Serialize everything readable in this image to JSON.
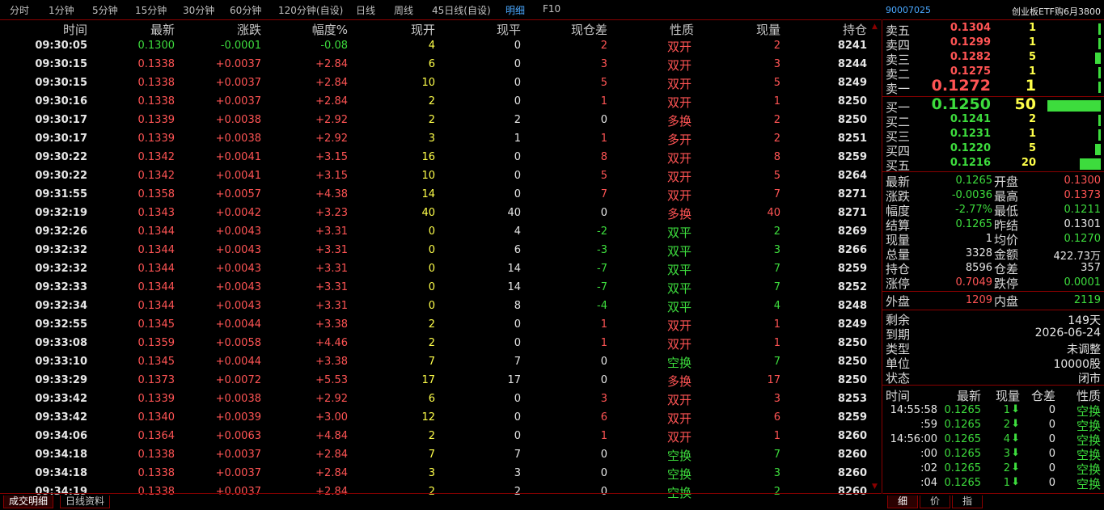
{
  "topbar": {
    "tabs": [
      "分时",
      "1分钟",
      "5分钟",
      "15分钟",
      "30分钟",
      "60分钟",
      "120分钟(自设)",
      "日线",
      "周线",
      "45日线(自设)",
      "明细",
      "F10"
    ],
    "active_index": 10
  },
  "table": {
    "headers": [
      "时间",
      "最新",
      "涨跌",
      "幅度%",
      "现开",
      "现平",
      "现仓差",
      "性质",
      "现量",
      "持仓"
    ],
    "rows": [
      [
        "09:30:05",
        "0.1300",
        "-0.0001",
        "-0.08",
        "4",
        "0",
        "2",
        "双开",
        "2",
        "8241"
      ],
      [
        "09:30:15",
        "0.1338",
        "+0.0037",
        "+2.84",
        "6",
        "0",
        "3",
        "双开",
        "3",
        "8244"
      ],
      [
        "09:30:15",
        "0.1338",
        "+0.0037",
        "+2.84",
        "10",
        "0",
        "5",
        "双开",
        "5",
        "8249"
      ],
      [
        "09:30:16",
        "0.1338",
        "+0.0037",
        "+2.84",
        "2",
        "0",
        "1",
        "双开",
        "1",
        "8250"
      ],
      [
        "09:30:17",
        "0.1339",
        "+0.0038",
        "+2.92",
        "2",
        "2",
        "0",
        "多换",
        "2",
        "8250"
      ],
      [
        "09:30:17",
        "0.1339",
        "+0.0038",
        "+2.92",
        "3",
        "1",
        "1",
        "多开",
        "2",
        "8251"
      ],
      [
        "09:30:22",
        "0.1342",
        "+0.0041",
        "+3.15",
        "16",
        "0",
        "8",
        "双开",
        "8",
        "8259"
      ],
      [
        "09:30:22",
        "0.1342",
        "+0.0041",
        "+3.15",
        "10",
        "0",
        "5",
        "双开",
        "5",
        "8264"
      ],
      [
        "09:31:55",
        "0.1358",
        "+0.0057",
        "+4.38",
        "14",
        "0",
        "7",
        "双开",
        "7",
        "8271"
      ],
      [
        "09:32:19",
        "0.1343",
        "+0.0042",
        "+3.23",
        "40",
        "40",
        "0",
        "多换",
        "40",
        "8271"
      ],
      [
        "09:32:26",
        "0.1344",
        "+0.0043",
        "+3.31",
        "0",
        "4",
        "-2",
        "双平",
        "2",
        "8269"
      ],
      [
        "09:32:32",
        "0.1344",
        "+0.0043",
        "+3.31",
        "0",
        "6",
        "-3",
        "双平",
        "3",
        "8266"
      ],
      [
        "09:32:32",
        "0.1344",
        "+0.0043",
        "+3.31",
        "0",
        "14",
        "-7",
        "双平",
        "7",
        "8259"
      ],
      [
        "09:32:33",
        "0.1344",
        "+0.0043",
        "+3.31",
        "0",
        "14",
        "-7",
        "双平",
        "7",
        "8252"
      ],
      [
        "09:32:34",
        "0.1344",
        "+0.0043",
        "+3.31",
        "0",
        "8",
        "-4",
        "双平",
        "4",
        "8248"
      ],
      [
        "09:32:55",
        "0.1345",
        "+0.0044",
        "+3.38",
        "2",
        "0",
        "1",
        "双开",
        "1",
        "8249"
      ],
      [
        "09:33:08",
        "0.1359",
        "+0.0058",
        "+4.46",
        "2",
        "0",
        "1",
        "双开",
        "1",
        "8250"
      ],
      [
        "09:33:10",
        "0.1345",
        "+0.0044",
        "+3.38",
        "7",
        "7",
        "0",
        "空换",
        "7",
        "8250"
      ],
      [
        "09:33:29",
        "0.1373",
        "+0.0072",
        "+5.53",
        "17",
        "17",
        "0",
        "多换",
        "17",
        "8250"
      ],
      [
        "09:33:42",
        "0.1339",
        "+0.0038",
        "+2.92",
        "6",
        "0",
        "3",
        "双开",
        "3",
        "8253"
      ],
      [
        "09:33:42",
        "0.1340",
        "+0.0039",
        "+3.00",
        "12",
        "0",
        "6",
        "双开",
        "6",
        "8259"
      ],
      [
        "09:34:06",
        "0.1364",
        "+0.0063",
        "+4.84",
        "2",
        "0",
        "1",
        "双开",
        "1",
        "8260"
      ],
      [
        "09:34:18",
        "0.1338",
        "+0.0037",
        "+2.84",
        "7",
        "7",
        "0",
        "空换",
        "7",
        "8260"
      ],
      [
        "09:34:18",
        "0.1338",
        "+0.0037",
        "+2.84",
        "3",
        "3",
        "0",
        "空换",
        "3",
        "8260"
      ],
      [
        "09:34:19",
        "0.1338",
        "+0.0037",
        "+2.84",
        "2",
        "2",
        "0",
        "空换",
        "2",
        "8260"
      ]
    ]
  },
  "bottom_tabs": [
    "成交明细",
    "日线资料"
  ],
  "side": {
    "code": "90007025",
    "name": "创业板ETF购6月3800",
    "asks": [
      {
        "label": "卖五",
        "price": "0.1304",
        "vol": "1",
        "bar": 0.02
      },
      {
        "label": "卖四",
        "price": "0.1299",
        "vol": "1",
        "bar": 0.02
      },
      {
        "label": "卖三",
        "price": "0.1282",
        "vol": "5",
        "bar": 0.1
      },
      {
        "label": "卖二",
        "price": "0.1275",
        "vol": "1",
        "bar": 0.02
      },
      {
        "label": "卖一",
        "price": "0.1272",
        "vol": "1",
        "bar": 0.02
      }
    ],
    "bids": [
      {
        "label": "买一",
        "price": "0.1250",
        "vol": "50",
        "bar": 1.0
      },
      {
        "label": "买二",
        "price": "0.1241",
        "vol": "2",
        "bar": 0.04
      },
      {
        "label": "买三",
        "price": "0.1231",
        "vol": "1",
        "bar": 0.02
      },
      {
        "label": "买四",
        "price": "0.1220",
        "vol": "5",
        "bar": 0.1
      },
      {
        "label": "买五",
        "price": "0.1216",
        "vol": "20",
        "bar": 0.4
      }
    ],
    "quote": [
      [
        "最新",
        "0.1265",
        "开盘",
        "0.1300"
      ],
      [
        "涨跌",
        "-0.0036",
        "最高",
        "0.1373"
      ],
      [
        "幅度",
        "-2.77%",
        "最低",
        "0.1211"
      ],
      [
        "结算",
        "0.1265",
        "昨结",
        "0.1301"
      ],
      [
        "现量",
        "1",
        "均价",
        "0.1270"
      ],
      [
        "总量",
        "3328",
        "金额",
        "422.73万"
      ],
      [
        "持仓",
        "8596",
        "仓差",
        "357"
      ],
      [
        "涨停",
        "0.7049",
        "跌停",
        "0.0001"
      ]
    ],
    "outer": [
      "外盘",
      "1209",
      "内盘",
      "2119"
    ],
    "info": [
      [
        "剩余",
        "149天"
      ],
      [
        "到期",
        "2026-06-24"
      ],
      [
        "类型",
        "未调整"
      ],
      [
        "单位",
        "10000股"
      ],
      [
        "状态",
        "闭市"
      ]
    ],
    "ticks_header": [
      "时间",
      "最新",
      "现量",
      "仓差",
      "性质"
    ],
    "ticks": [
      [
        "14:55:58",
        "0.1265",
        "1",
        "0",
        "空换"
      ],
      [
        ":59",
        "0.1265",
        "2",
        "0",
        "空换"
      ],
      [
        "14:56:00",
        "0.1265",
        "4",
        "0",
        "空换"
      ],
      [
        ":00",
        "0.1265",
        "3",
        "0",
        "空换"
      ],
      [
        ":02",
        "0.1265",
        "2",
        "0",
        "空换"
      ],
      [
        ":04",
        "0.1265",
        "1",
        "0",
        "空换"
      ]
    ],
    "bottom_tabs": [
      "细",
      "价",
      "指"
    ]
  },
  "colors": {
    "red": "#ff5454",
    "green": "#3ddc3d",
    "yellow": "#ffff4a",
    "border": "#8a0000",
    "blue": "#4aa8ff"
  }
}
